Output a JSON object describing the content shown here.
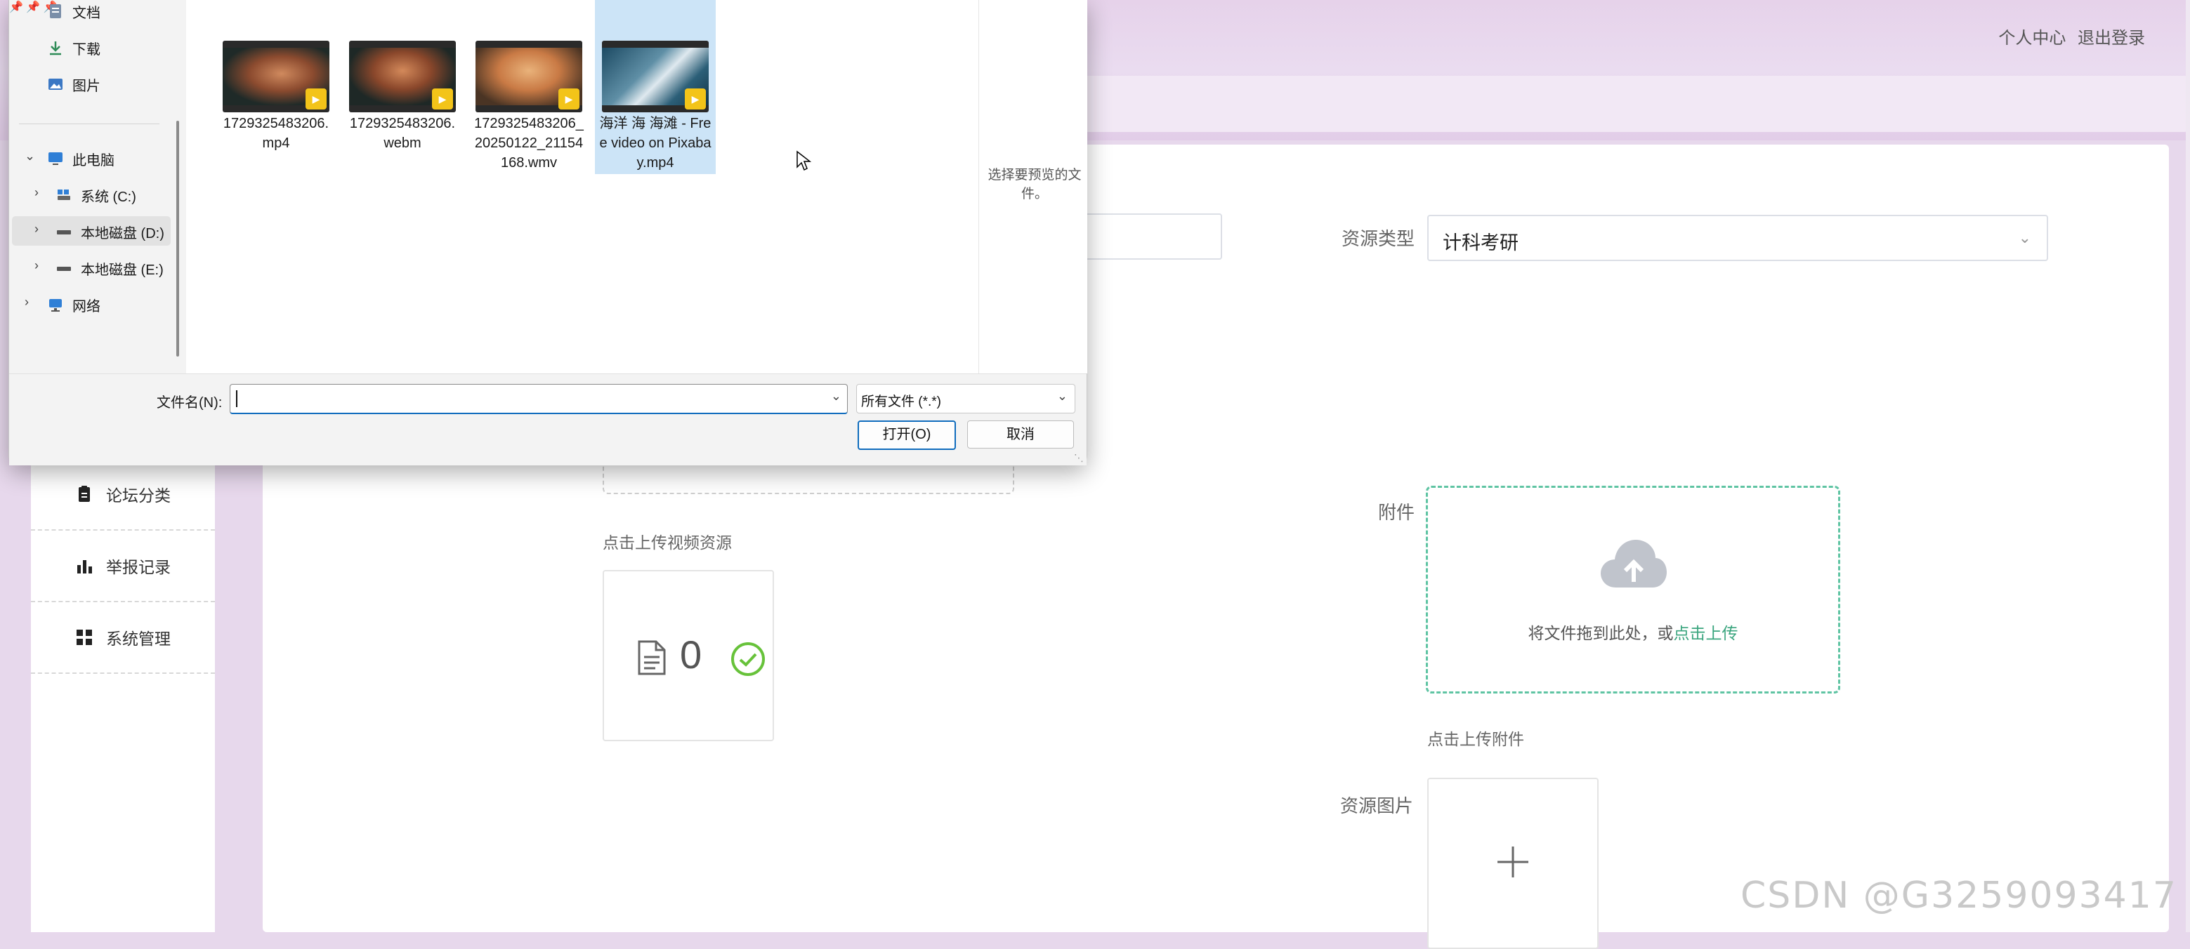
{
  "header": {
    "personal_center": "个人中心",
    "logout": "退出登录"
  },
  "sidebar": {
    "items": [
      {
        "label": "论坛分类",
        "icon": "clipboard-icon"
      },
      {
        "label": "举报记录",
        "icon": "bar-chart-icon"
      },
      {
        "label": "系统管理",
        "icon": "grid-icon"
      }
    ]
  },
  "form": {
    "resource_type_label": "资源类型",
    "resource_type_value": "计科考研",
    "video_upload_hint": "点击上传视频资源",
    "video_count": "0",
    "attachment_label": "附件",
    "drag_text": "将文件拖到此处，或",
    "drag_link": "点击上传",
    "attachment_hint": "点击上传附件",
    "resource_image_label": "资源图片",
    "plus": "+"
  },
  "dialog": {
    "nav": {
      "quick_access": [
        {
          "label": "文档",
          "icon": "document-icon"
        },
        {
          "label": "下载",
          "icon": "download-icon"
        },
        {
          "label": "图片",
          "icon": "pictures-icon"
        }
      ],
      "this_pc": "此电脑",
      "drives": [
        {
          "label": "系统 (C:)"
        },
        {
          "label": "本地磁盘 (D:)"
        },
        {
          "label": "本地磁盘 (E:)"
        }
      ],
      "network": "网络"
    },
    "files": [
      {
        "name": "1729325483206.mp4",
        "selected": false
      },
      {
        "name": "1729325483206.webm",
        "selected": false
      },
      {
        "name": "1729325483206_20250122_21154168.wmv",
        "selected": false
      },
      {
        "name": "海洋 海 海滩 - Free video on Pixabay.mp4",
        "selected": true
      }
    ],
    "preview_text": "选择要预览的文件。",
    "filename_label": "文件名(N):",
    "filename_value": "",
    "filter_value": "所有文件 (*.*)",
    "open_button": "打开(O)",
    "cancel_button": "取消"
  },
  "watermark": "CSDN @G3259093417",
  "colors": {
    "accent_green": "#3aa57e",
    "dialog_accent": "#0f6cbd",
    "header_bg": "#e6d2ea",
    "check_green": "#67c23a"
  }
}
